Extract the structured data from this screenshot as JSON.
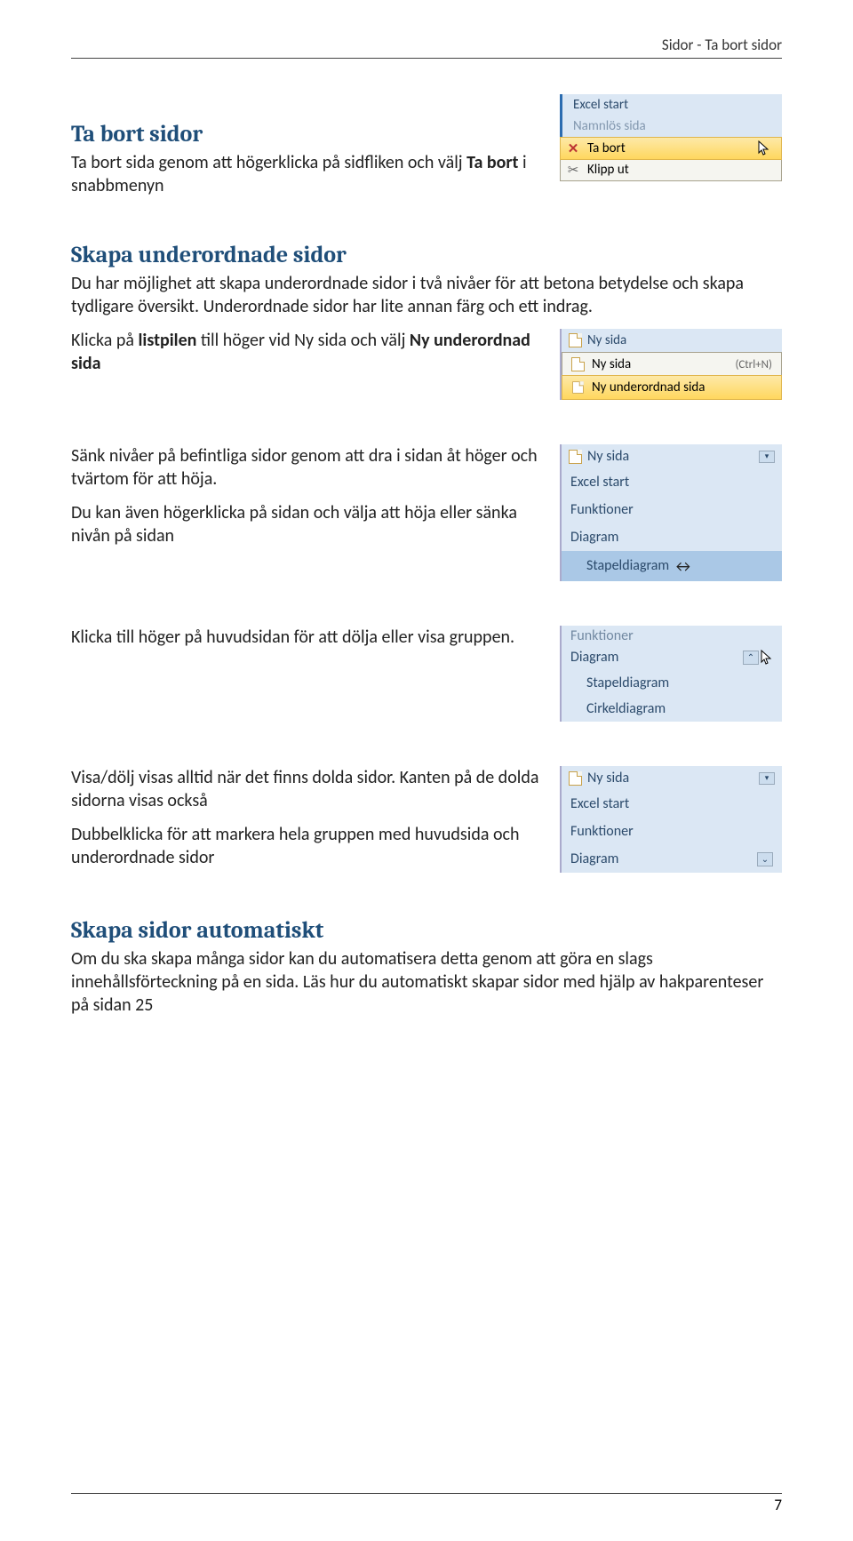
{
  "header": "Sidor - Ta bort sidor",
  "section1": {
    "heading": "Ta bort sidor",
    "p1a": "Ta bort sida genom att högerklicka på sidfliken och välj ",
    "p1b": "Ta bort",
    "p1c": " i snabbmenyn",
    "shot": {
      "row1": "Excel start",
      "row2": "Namnlös sida",
      "menu1": "Ta bort",
      "menu2": "Klipp ut"
    }
  },
  "section2": {
    "heading": "Skapa underordnade sidor",
    "p1": "Du har möjlighet att skapa underordnade sidor i två nivåer för att betona betydelse och skapa tydligare översikt. Underordnade sidor har lite annan färg och ett indrag.",
    "p2a": "Klicka på ",
    "p2b": "listpilen",
    "p2c": " till höger vid Ny sida och välj ",
    "p2d": "Ny underordnad sida",
    "shot": {
      "top": "Ny sida",
      "m1": "Ny sida",
      "m1s": "(Ctrl+N)",
      "m2": "Ny underordnad sida"
    }
  },
  "section3": {
    "p1": "Sänk nivåer på befintliga sidor genom att dra i sidan åt höger och tvärtom för att höja.",
    "p2": "Du kan även högerklicka på sidan och välja att höja eller sänka nivån på sidan",
    "shot": {
      "top": "Ny sida",
      "i1": "Excel start",
      "i2": "Funktioner",
      "i3": "Diagram",
      "i4": "Stapeldiagram"
    }
  },
  "section4": {
    "p1": "Klicka till höger på huvudsidan för att dölja eller visa gruppen.",
    "shot": {
      "i0": "Funktioner",
      "i1": "Diagram",
      "i2": "Stapeldiagram",
      "i3": "Cirkeldiagram"
    }
  },
  "section5": {
    "p1": "Visa/dölj visas alltid när det finns dolda sidor. Kanten på de dolda sidorna visas också",
    "p2": "Dubbelklicka för att markera hela gruppen med huvudsida och underordnade sidor",
    "shot": {
      "top": "Ny sida",
      "i1": "Excel start",
      "i2": "Funktioner",
      "i3": "Diagram"
    }
  },
  "section6": {
    "heading": "Skapa sidor automatiskt",
    "p1": "Om du ska skapa många sidor kan du automatisera detta genom att göra en slags innehållsförteckning på en sida. Läs hur du automatiskt skapar sidor med hjälp av hakparenteser på sidan 25"
  },
  "footer": "7"
}
